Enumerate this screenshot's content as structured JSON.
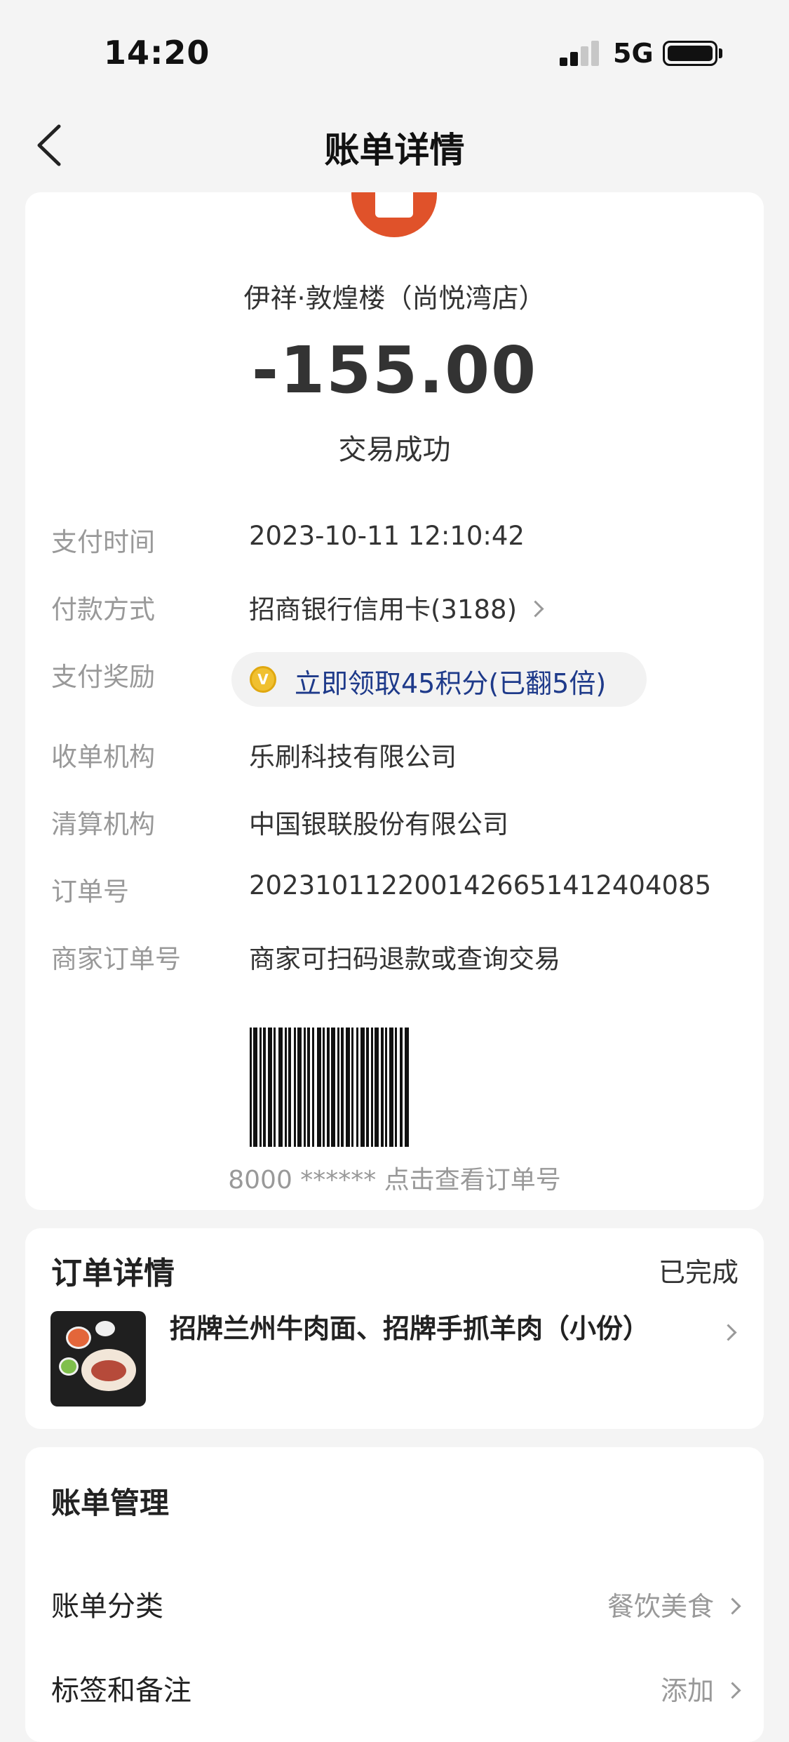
{
  "status_bar": {
    "time": "14:20",
    "network": "5G"
  },
  "nav": {
    "title": "账单详情"
  },
  "merchant": {
    "name": "伊祥·敦煌楼（尚悦湾店）",
    "amount": "-155.00",
    "status": "交易成功"
  },
  "details": {
    "pay_time": {
      "label": "支付时间",
      "value": "2023-10-11 12:10:42"
    },
    "pay_method": {
      "label": "付款方式",
      "value": "招商银行信用卡(3188)"
    },
    "reward": {
      "label": "支付奖励",
      "value": "立即领取45积分(已翻5倍)"
    },
    "acquirer": {
      "label": "收单机构",
      "value": "乐刷科技有限公司"
    },
    "clearing": {
      "label": "清算机构",
      "value": "中国银联股份有限公司"
    },
    "order_no": {
      "label": "订单号",
      "value": "2023101122001426651412404085"
    },
    "merchant_order": {
      "label": "商家订单号",
      "value": "商家可扫码退款或查询交易"
    }
  },
  "barcode": {
    "text": "8000 ****** 点击查看订单号"
  },
  "order": {
    "title": "订单详情",
    "status": "已完成",
    "items": "招牌兰州牛肉面、招牌手抓羊肉（小份）"
  },
  "bill": {
    "title": "账单管理",
    "category": {
      "label": "账单分类",
      "value": "餐饮美食"
    },
    "tags": {
      "label": "标签和备注",
      "value": "添加"
    }
  }
}
